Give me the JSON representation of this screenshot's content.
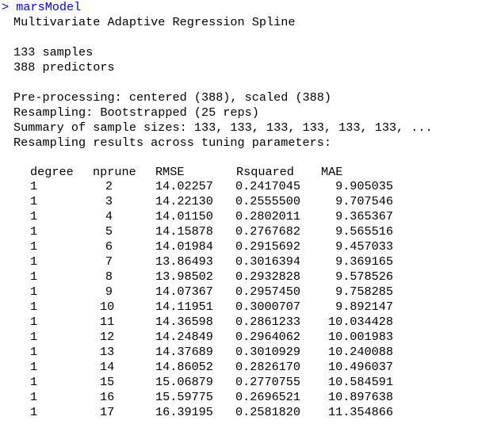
{
  "console": {
    "prompt": ">",
    "command": "marsModel",
    "model_title": "Multivariate Adaptive Regression Spline",
    "samples_line": "133 samples",
    "predictors_line": "388 predictors",
    "preprocessing_line": "Pre-processing: centered (388), scaled (388)",
    "resampling_line": "Resampling: Bootstrapped (25 reps)",
    "summary_line": "Summary of sample sizes: 133, 133, 133, 133, 133, 133, ...",
    "results_heading": "Resampling results across tuning parameters:"
  },
  "table": {
    "headers": [
      "degree",
      "nprune",
      "RMSE",
      "Rsquared",
      "MAE"
    ],
    "rows": [
      [
        "1",
        "2",
        "14.02257",
        "0.2417045",
        "9.905035"
      ],
      [
        "1",
        "3",
        "14.22130",
        "0.2555500",
        "9.707546"
      ],
      [
        "1",
        "4",
        "14.01150",
        "0.2802011",
        "9.365367"
      ],
      [
        "1",
        "5",
        "14.15878",
        "0.2767682",
        "9.565516"
      ],
      [
        "1",
        "6",
        "14.01984",
        "0.2915692",
        "9.457033"
      ],
      [
        "1",
        "7",
        "13.86493",
        "0.3016394",
        "9.369165"
      ],
      [
        "1",
        "8",
        "13.98502",
        "0.2932828",
        "9.578526"
      ],
      [
        "1",
        "9",
        "14.07367",
        "0.2957450",
        "9.758285"
      ],
      [
        "1",
        "10",
        "14.11951",
        "0.3000707",
        "9.892147"
      ],
      [
        "1",
        "11",
        "14.36598",
        "0.2861233",
        "10.034428"
      ],
      [
        "1",
        "12",
        "14.24849",
        "0.2964062",
        "10.001983"
      ],
      [
        "1",
        "13",
        "14.37689",
        "0.3010929",
        "10.240088"
      ],
      [
        "1",
        "14",
        "14.86052",
        "0.2826170",
        "10.496037"
      ],
      [
        "1",
        "15",
        "15.06879",
        "0.2770755",
        "10.584591"
      ],
      [
        "1",
        "16",
        "15.59775",
        "0.2696521",
        "10.897638"
      ],
      [
        "1",
        "17",
        "16.39195",
        "0.2581820",
        "11.354866"
      ]
    ]
  },
  "colors": {
    "command": "#0000ff",
    "output": "#000000",
    "background": "#ffffff"
  }
}
